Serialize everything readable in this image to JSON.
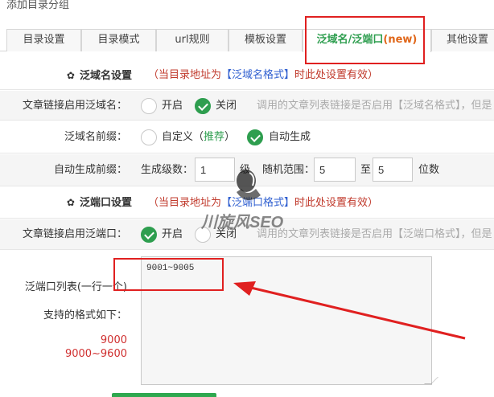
{
  "page_title": "添加目录分组",
  "tabs": [
    {
      "label": "目录设置"
    },
    {
      "label": "目录模式"
    },
    {
      "label": "url规则"
    },
    {
      "label": "模板设置"
    },
    {
      "label": "泛域名/泛端口",
      "tag": "(new)",
      "active": true
    },
    {
      "label": "其他设置"
    }
  ],
  "domain_section": {
    "title": "泛域名设置",
    "notice_before": "（当目录地址为",
    "notice_highlight": "【泛域名格式】",
    "notice_after": "时此处设置有效）"
  },
  "link_domain": {
    "label": "文章链接启用泛域名：",
    "options": [
      "开启",
      "关闭"
    ],
    "selected": "关闭",
    "hint": "调用的文章列表链接是否启用【泛域名格式】，但是"
  },
  "domain_prefix": {
    "label": "泛域名前缀：",
    "custom_label": "自定义（",
    "custom_recommend": "推荐",
    "custom_close": "）",
    "auto_label": "自动生成",
    "selected": "自动生成"
  },
  "auto_prefix": {
    "label": "自动生成前缀：",
    "level_label": "生成级数：",
    "level_value": "1",
    "level_unit": "级",
    "range_label": "随机范围：",
    "range_from": "5",
    "range_to_label": "至",
    "range_to": "5",
    "range_unit": "位数"
  },
  "port_section": {
    "title": "泛端口设置",
    "notice_before": "（当目录地址为",
    "notice_highlight": "【泛端口格式】",
    "notice_after": "时此处设置有效）"
  },
  "link_port": {
    "label": "文章链接启用泛端口：",
    "options": [
      "开启",
      "关闭"
    ],
    "selected": "开启",
    "hint": "调用的文章列表链接是否启用【泛端口格式】，但是"
  },
  "port_list": {
    "label": "泛端口列表(一行一个)",
    "format_label": "支持的格式如下：",
    "example_1": "9000",
    "example_2": "9000~9600",
    "value": "9001~9005"
  },
  "watermark": {
    "text": "川旋风SEO"
  },
  "colors": {
    "accent_green": "#2e9e4f",
    "notice_red": "#c0392b",
    "highlight_blue": "#2f5fd0",
    "annotation_red": "#e02020"
  }
}
